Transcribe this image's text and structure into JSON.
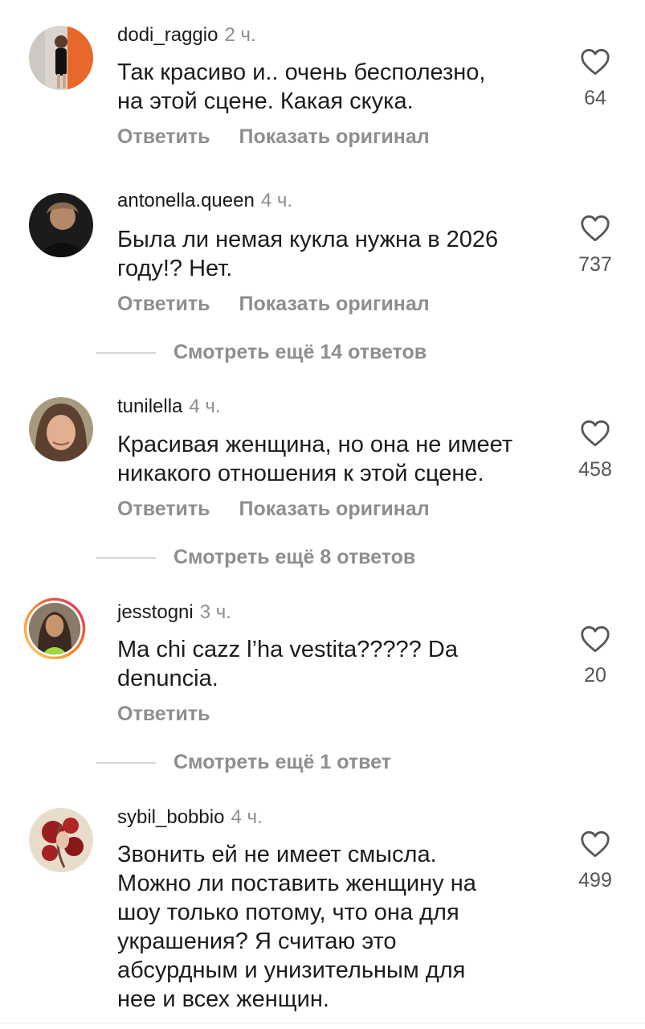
{
  "comments": [
    {
      "username": "dodi_raggio",
      "time": "2 ч.",
      "text_lines": [
        "Так красиво и.. очень бесполезно,",
        "на этой сцене. Какая скука."
      ],
      "likes": "64",
      "reply_label": "Ответить",
      "original_label": "Показать оригинал"
    },
    {
      "username": "antonella.queen",
      "time": "4 ч.",
      "text_lines": [
        "Была ли немая кукла нужна в 2026",
        "году!? Нет."
      ],
      "likes": "737",
      "reply_label": "Ответить",
      "original_label": "Показать оригинал",
      "more_replies": "Смотреть ещё 14 ответов"
    },
    {
      "username": "tunilella",
      "time": "4 ч.",
      "text_lines": [
        "Красивая женщина, но она не имеет",
        "никакого отношения к этой сцене."
      ],
      "likes": "458",
      "reply_label": "Ответить",
      "original_label": "Показать оригинал",
      "more_replies": "Смотреть ещё 8 ответов"
    },
    {
      "username": "jesstogni",
      "time": "3 ч.",
      "text_lines": [
        "Ma chi cazz l’ha vestita????? Da",
        "denuncia."
      ],
      "likes": "20",
      "reply_label": "Ответить",
      "more_replies": "Смотреть ещё 1 ответ"
    },
    {
      "username": "sybil_bobbio",
      "time": "4 ч.",
      "text_lines": [
        "Звонить ей не имеет смысла.",
        "Можно ли поставить женщину на",
        "шоу только потому, что она для",
        "украшения? Я считаю это",
        "абсурдным и унизительным для",
        "нее и всех женщин."
      ],
      "likes": "499"
    }
  ],
  "icons": {
    "like": "heart-outline-icon"
  },
  "colors": {
    "secondary_text": "#8e8e8e",
    "story_ring_start": "#feda75",
    "story_ring_end": "#d62976"
  }
}
